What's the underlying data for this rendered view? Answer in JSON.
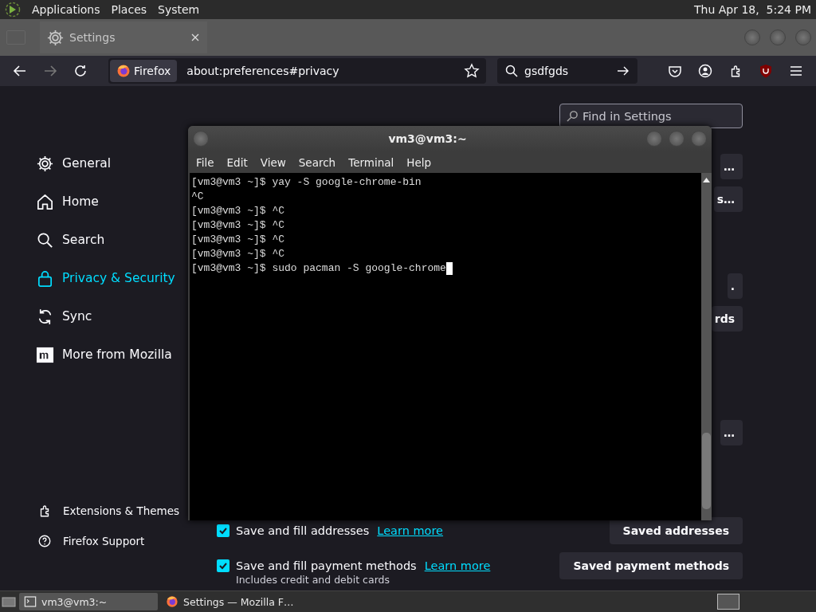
{
  "top_panel": {
    "menus": [
      "Applications",
      "Places",
      "System"
    ],
    "clock": "Thu Apr 18,  5:24 PM"
  },
  "browser": {
    "tabs": [
      {
        "label": "Settings"
      }
    ],
    "identity": "Firefox",
    "url": "about:preferences#privacy",
    "search": {
      "value": "gsdfgds"
    }
  },
  "settings": {
    "find_placeholder": "Find in Settings",
    "nav": [
      {
        "label": "General",
        "selected": false
      },
      {
        "label": "Home",
        "selected": false
      },
      {
        "label": "Search",
        "selected": false
      },
      {
        "label": "Privacy & Security",
        "selected": true
      },
      {
        "label": "Sync",
        "selected": false
      },
      {
        "label": "More from Mozilla",
        "selected": false
      }
    ],
    "footer_links": [
      {
        "label": "Extensions & Themes"
      },
      {
        "label": "Firefox Support"
      }
    ],
    "partial_buttons": [
      "…",
      "s…",
      ".",
      "rds",
      "…"
    ],
    "options": [
      {
        "label": "Save and fill addresses",
        "checked": true,
        "link": "Learn more",
        "button": "Saved addresses"
      },
      {
        "label": "Save and fill payment methods",
        "checked": true,
        "link": "Learn more",
        "button": "Saved payment methods",
        "note": "Includes credit and debit cards"
      }
    ]
  },
  "terminal": {
    "title": "vm3@vm3:~",
    "menus": [
      "File",
      "Edit",
      "View",
      "Search",
      "Terminal",
      "Help"
    ],
    "lines": [
      "[vm3@vm3 ~]$ yay -S google-chrome-bin",
      "^C",
      "[vm3@vm3 ~]$ ^C",
      "[vm3@vm3 ~]$ ^C",
      "[vm3@vm3 ~]$ ^C",
      "[vm3@vm3 ~]$ ^C",
      "[vm3@vm3 ~]$ sudo pacman -S google-chrome"
    ]
  },
  "taskbar": {
    "items": [
      {
        "label": "vm3@vm3:~",
        "selected": true
      },
      {
        "label": "Settings — Mozilla F…",
        "selected": false
      }
    ]
  }
}
